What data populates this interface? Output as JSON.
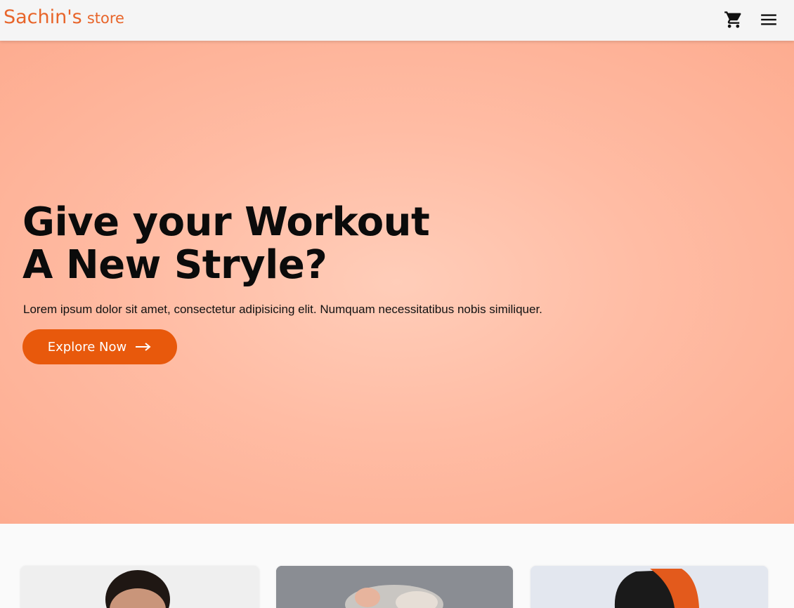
{
  "navbar": {
    "brand_main": "Sachin's",
    "brand_sub": "store",
    "cart_icon": "shopping-cart-icon",
    "menu_icon": "hamburger-menu-icon"
  },
  "hero": {
    "title_line1": "Give your Workout",
    "title_line2": "A New Stryle?",
    "text": "Lorem ipsum dolor sit amet, consectetur adipisicing elit. Numquam necessitatibus nobis similiquer.",
    "button_label": "Explore Now",
    "button_icon": "arrow-right-icon"
  },
  "products": [
    {
      "image": "man-portrait-image"
    },
    {
      "image": "woman-headphones-image"
    },
    {
      "image": "smartwatch-image"
    }
  ],
  "colors": {
    "brand": "#e8652a",
    "button": "#e8590c",
    "hero_bg": "#ffbca4"
  }
}
